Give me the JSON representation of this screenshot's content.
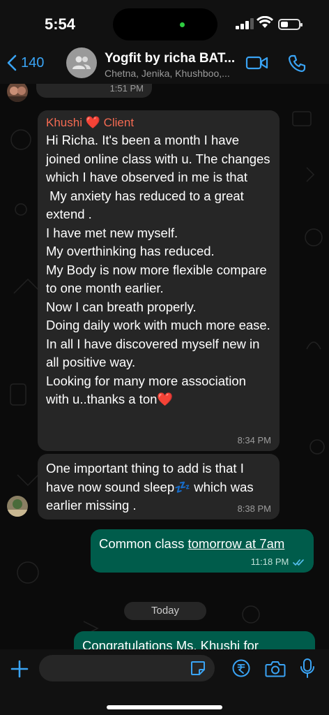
{
  "status_bar": {
    "time": "5:54"
  },
  "header": {
    "back_count": "140",
    "group_name": "Yogfit by richa BAT...",
    "members": "Chetna, Jenika, Khushboo,..."
  },
  "messages": [
    {
      "time": "1:51 PM"
    },
    {
      "sender": "Khushi ❤️ Client",
      "text": "Hi Richa. It's been a month I have joined online class with u. The changes which I have observed in me is that\n My anxiety has reduced to a great extend .\nI have met new myself.\nMy overthinking has reduced.\nMy Body is now more flexible compare to one month earlier.\nNow I can breath properly.\nDoing daily work with much more ease.\nIn all I have discovered myself new in all positive way.\nLooking for many more association with u..thanks a ton❤️",
      "time": "8:34 PM"
    },
    {
      "text": "One important thing to add is that I have now sound sleep💤 which was earlier missing .",
      "time": "8:38 PM"
    },
    {
      "text_prefix": "Common class ",
      "text_link": "tomorrow at 7am",
      "time": "11:18 PM"
    },
    {
      "text": "Congratulations Ms. Khushi for"
    }
  ],
  "date_separator": "Today",
  "colors": {
    "accent": "#3aa4f5",
    "outgoing": "#005c4b",
    "incoming": "#262626",
    "sender_name": "#f46a52"
  },
  "icons": [
    "back-chevron-icon",
    "group-avatar-icon",
    "video-call-icon",
    "phone-icon",
    "plus-icon",
    "sticker-icon",
    "rupee-payment-icon",
    "camera-icon",
    "microphone-icon",
    "double-check-icon"
  ]
}
